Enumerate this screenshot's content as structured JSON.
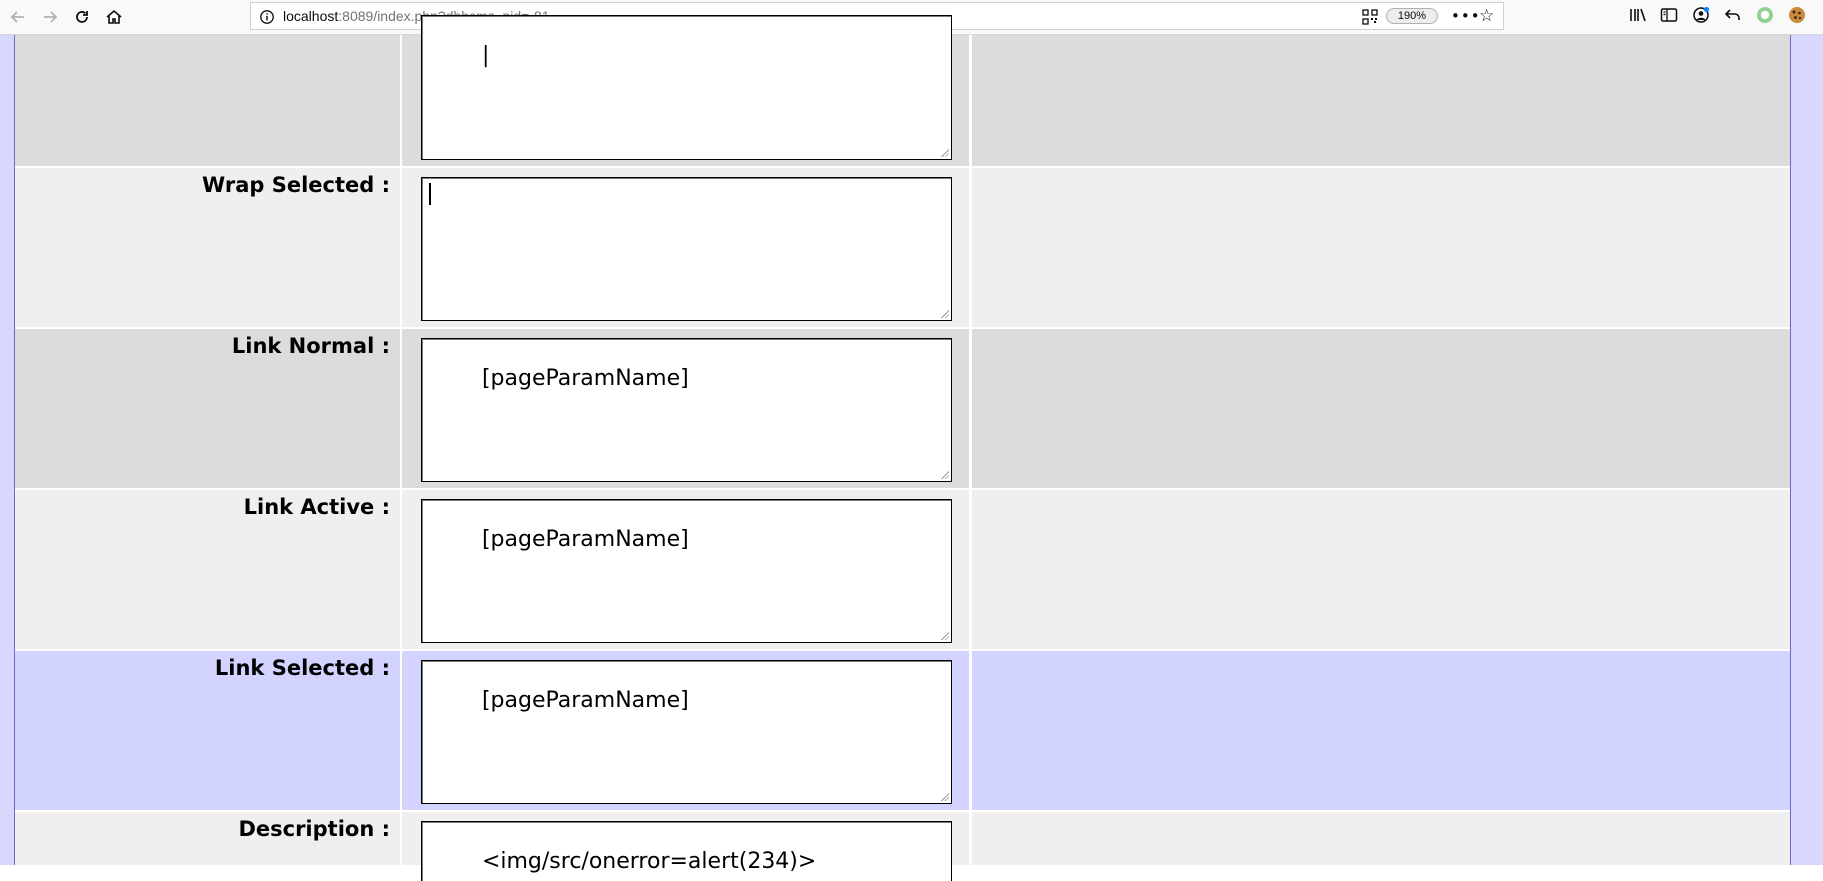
{
  "browser": {
    "url_host": "localhost",
    "url_rest": ":8089/index.php?dbhcms_pid=-81",
    "zoom": "190%",
    "icons": [
      "back-icon",
      "forward-icon",
      "reload-icon",
      "home-icon",
      "info-icon",
      "qr-code-icon",
      "page-actions-icon",
      "bookmark-star-icon",
      "library-icon",
      "sidebar-icon",
      "account-icon",
      "undo-icon",
      "extension-icon",
      "cookie-icon"
    ]
  },
  "colors": {
    "row_dark": "#dcdcdc",
    "row_light": "#efefef",
    "row_highlight": "#d3d3ff",
    "page_border": "#6a6ac8"
  },
  "form": {
    "rows": [
      {
        "label": "",
        "value": "|"
      },
      {
        "label": "Wrap Selected :",
        "value": ""
      },
      {
        "label": "Link Normal :",
        "value": "[pageParamName]"
      },
      {
        "label": "Link Active :",
        "value": "[pageParamName]"
      },
      {
        "label": "Link Selected :",
        "value": "[pageParamName]"
      },
      {
        "label": "Description :",
        "value": "<img/src/onerror=alert(234)>"
      }
    ]
  }
}
